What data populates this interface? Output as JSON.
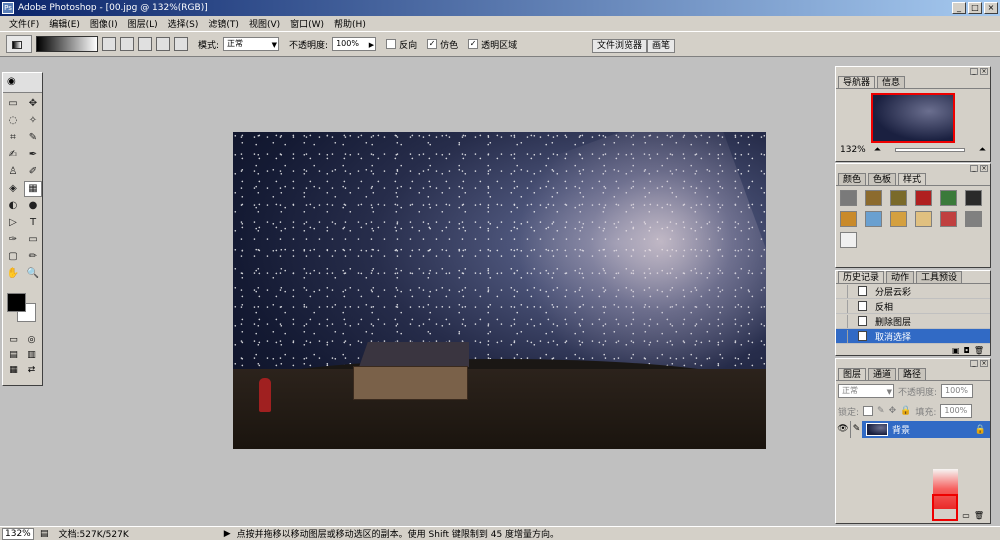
{
  "window": {
    "title": "Adobe Photoshop - [00.jpg @ 132%(RGB)]",
    "min_label": "_",
    "max_label": "□",
    "close_label": "×"
  },
  "menu": [
    "文件(F)",
    "编辑(E)",
    "图像(I)",
    "图层(L)",
    "选择(S)",
    "滤镜(T)",
    "视图(V)",
    "窗口(W)",
    "帮助(H)"
  ],
  "options": {
    "mode_label": "模式:",
    "mode_value": "正常",
    "opacity_label": "不透明度:",
    "opacity_value": "100%",
    "reverse_label": "反向",
    "reverse_checked": false,
    "dither_label": "仿色",
    "dither_checked": true,
    "transparency_label": "透明区域",
    "transparency_checked": true
  },
  "palette_well": {
    "tabs": [
      "文件浏览器",
      "画笔"
    ]
  },
  "toolbox": {
    "tools": [
      "▭",
      "✥",
      "◌",
      "✧",
      "⌗",
      "✎",
      "✍",
      "✒",
      "♙",
      "✐",
      "◈",
      "▦",
      "◐",
      "●",
      "▷",
      "T",
      "✑",
      "▭",
      "▢",
      "✏",
      "✋",
      "🔍"
    ],
    "colors": {
      "foreground": "#000000",
      "background": "#ffffff"
    }
  },
  "status": {
    "zoom": "132%",
    "doc": "文档:527K/527K",
    "hint": "点按并拖移以移动图层或移动选区的副本。使用 Shift 键限制到 45 度增量方向。"
  },
  "navigator": {
    "tabs": [
      "导航器",
      "信息"
    ],
    "zoom": "132%"
  },
  "swatches_panel": {
    "tabs": [
      "颜色",
      "色板",
      "样式"
    ],
    "colors": [
      "#7a7a7a",
      "#8c6b2e",
      "#7a6a2a",
      "#b02020",
      "#3a7a3a",
      "#2a2a2a",
      "#c98a2a",
      "#6aa0d0",
      "#d4a040",
      "#e0c080",
      "#c04040",
      "#808080",
      "#f0f0f0"
    ]
  },
  "history": {
    "tabs": [
      "历史记录",
      "动作",
      "工具预设"
    ],
    "items": [
      "分层云彩",
      "反相",
      "删除图层",
      "取消选择"
    ]
  },
  "layers": {
    "tabs": [
      "图层",
      "通道",
      "路径"
    ],
    "blend": "正常",
    "opacity_label": "不透明度:",
    "opacity_value": "100%",
    "lock_label": "锁定:",
    "fill_label": "填充:",
    "fill_value": "100%",
    "layer_name": "背景"
  }
}
